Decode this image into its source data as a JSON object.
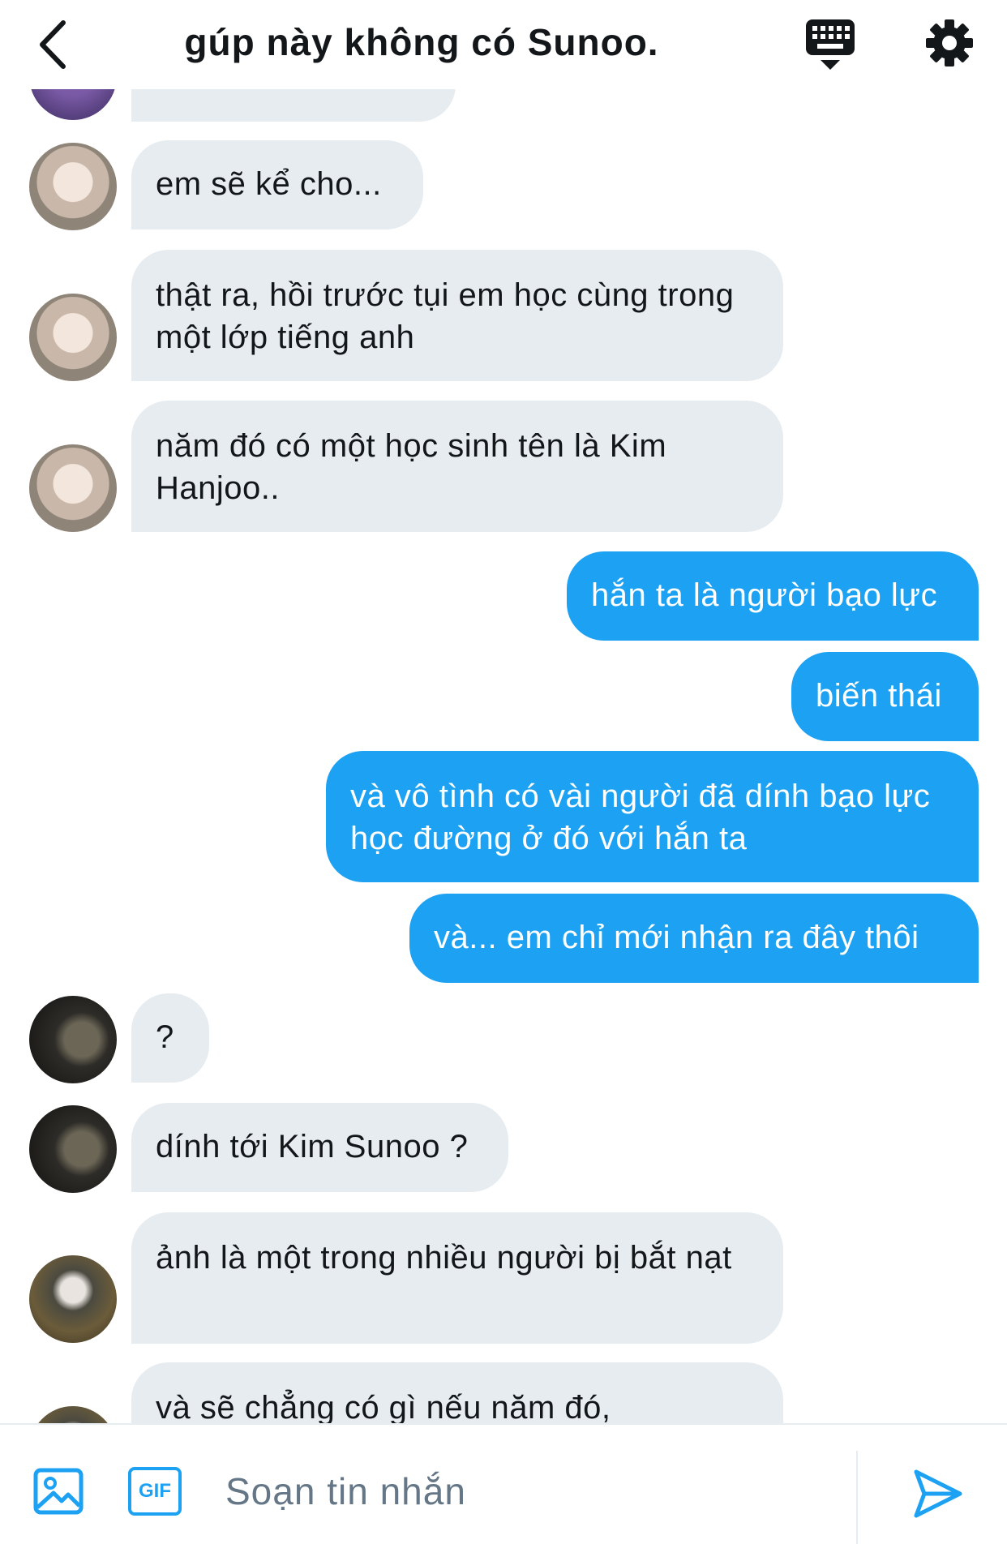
{
  "header": {
    "title": "gúp này không có Sunoo.",
    "back_icon": "chevron-left-icon",
    "keyboard_icon": "keyboard-hide-icon",
    "settings_icon": "gear-icon"
  },
  "messages": [
    {
      "side": "in",
      "text": ""
    },
    {
      "side": "in",
      "text": "em sẽ kể cho..."
    },
    {
      "side": "in",
      "text": "thật ra, hồi trước tụi em học cùng trong một lớp tiếng anh"
    },
    {
      "side": "in",
      "text": "năm đó có một học sinh tên là Kim Hanjoo.."
    },
    {
      "side": "out",
      "text": "hắn ta là người bạo lực"
    },
    {
      "side": "out",
      "text": "biến thái"
    },
    {
      "side": "out",
      "text": "và vô tình có vài người đã dính bạo lực học đường ở đó với hắn ta"
    },
    {
      "side": "out",
      "text": "và... em chỉ mới nhận ra đây thôi"
    },
    {
      "side": "in",
      "text": "?"
    },
    {
      "side": "in",
      "text": "dính tới Kim Sunoo ?"
    },
    {
      "side": "in",
      "text": "ảnh là một trong nhiều người bị bắt nạt"
    },
    {
      "side": "in",
      "text": "và sẽ chẳng có gì nếu năm đó,"
    }
  ],
  "composer": {
    "placeholder": "Soạn tin nhắn",
    "gif_label": "GIF",
    "image_icon": "image-icon",
    "send_icon": "send-icon"
  },
  "colors": {
    "accent": "#1da1f2",
    "incoming_bubble": "#e6ecf0",
    "text": "#14171a",
    "placeholder": "#657786"
  }
}
